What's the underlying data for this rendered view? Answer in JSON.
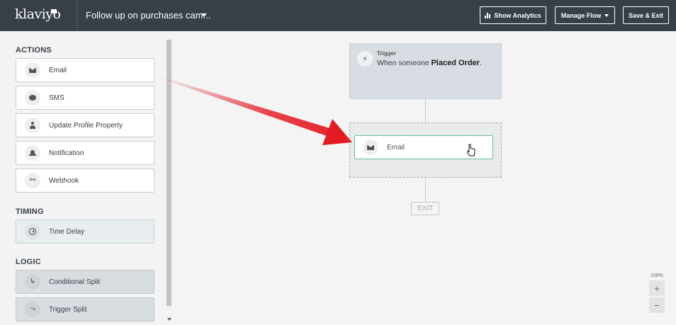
{
  "header": {
    "logo": "klaviyo",
    "flow_title": "Follow up on purchases cam...",
    "show_analytics": "Show Analytics",
    "manage_flow": "Manage Flow",
    "save_exit": "Save & Exit"
  },
  "sidebar": {
    "actions_heading": "ACTIONS",
    "actions": [
      {
        "label": "Email",
        "icon": "envelope-icon"
      },
      {
        "label": "SMS",
        "icon": "chat-bubble-icon"
      },
      {
        "label": "Update Profile Property",
        "icon": "person-icon"
      },
      {
        "label": "Notification",
        "icon": "bell-icon"
      },
      {
        "label": "Webhook",
        "icon": "webhook-icon"
      }
    ],
    "timing_heading": "TIMING",
    "timing": [
      {
        "label": "Time Delay",
        "icon": "clock-icon"
      }
    ],
    "logic_heading": "LOGIC",
    "logic": [
      {
        "label": "Conditional Split",
        "icon": "split-icon"
      },
      {
        "label": "Trigger Split",
        "icon": "trigger-split-icon"
      }
    ]
  },
  "canvas": {
    "trigger": {
      "label": "Trigger",
      "desc_prefix": "When someone ",
      "desc_bold": "Placed Order",
      "desc_suffix": "."
    },
    "email_node": {
      "label": "Email"
    },
    "exit_label": "EXIT",
    "zoom": {
      "level": "100%",
      "plus": "+",
      "minus": "−"
    }
  },
  "colors": {
    "topbar": "#373f47",
    "accent_green": "#5fc28e",
    "arrow_red": "#e31b23"
  }
}
